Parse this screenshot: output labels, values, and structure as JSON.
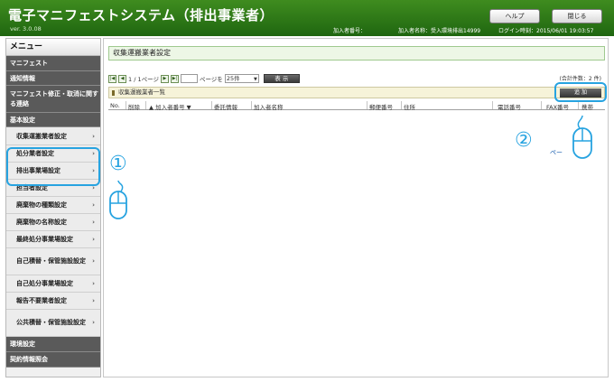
{
  "header": {
    "app_title": "電子マニフェストシステム（排出事業者）",
    "version": "ver. 3.0.08",
    "member_no_label": "加入者番号：",
    "member_name_label": "加入者名称：受入環境排出14999",
    "login_time": "ログイン時刻：2015/06/01 19:03:57",
    "help_button": "ヘルプ",
    "close_button": "閉じる"
  },
  "sidebar": {
    "title": "メニュー",
    "items": [
      {
        "type": "section",
        "label": "マニフェスト"
      },
      {
        "type": "section",
        "label": "通知情報"
      },
      {
        "type": "section",
        "label": "マニフェスト修正・取消に関する連絡"
      },
      {
        "type": "section",
        "label": "基本設定"
      },
      {
        "type": "sub",
        "label": "収集運搬業者設定"
      },
      {
        "type": "sub",
        "label": "処分業者設定"
      },
      {
        "type": "sub",
        "label": "排出事業場設定"
      },
      {
        "type": "sub",
        "label": "担当者設定"
      },
      {
        "type": "sub",
        "label": "廃棄物の種類設定"
      },
      {
        "type": "sub",
        "label": "廃棄物の名称設定"
      },
      {
        "type": "sub",
        "label": "最終処分事業場設定"
      },
      {
        "type": "sub",
        "label": "自己積替・保管施設設定"
      },
      {
        "type": "sub",
        "label": "自己処分事業場設定"
      },
      {
        "type": "sub",
        "label": "報告不要業者設定"
      },
      {
        "type": "sub",
        "label": "公共積替・保管施設設定"
      },
      {
        "type": "section",
        "label": "環境設定"
      },
      {
        "type": "section",
        "label": "契約情報照会"
      }
    ],
    "arrow": "›"
  },
  "main": {
    "page_title": "収集運搬業者設定",
    "pager": {
      "first_icon": "first-page-icon",
      "prev_icon": "prev-page-icon",
      "page_text": "1 / 1ページ",
      "next_icon": "next-page-icon",
      "last_icon": "last-page-icon",
      "page_input_value": "",
      "page_suffix": "ページを",
      "per_page_value": "25件",
      "show_button": "表 示"
    },
    "total_count": "(合計件数：2 件)",
    "list_title": "収集運搬業者一覧",
    "add_button": "追 加",
    "columns": [
      "No.",
      "削除",
      "▲ 加入者番号 ▼",
      "委託情報",
      "加入者名称",
      "郵便番号",
      "住所",
      "電話番号",
      "FAX番号",
      "携帯"
    ],
    "page_link": "ペー"
  },
  "annotations": {
    "marker_1": "①",
    "marker_2": "②",
    "accent_color": "#27a3e0",
    "mouse_icon": "mouse-icon"
  }
}
